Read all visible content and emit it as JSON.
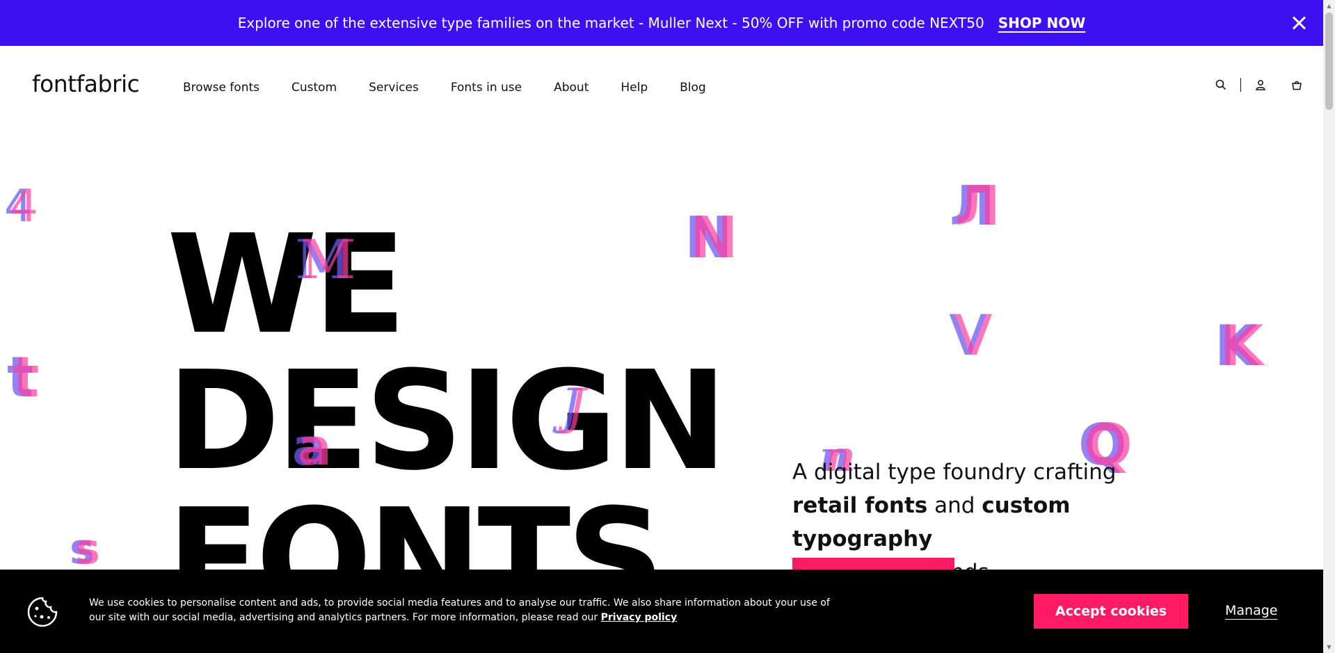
{
  "promo": {
    "text": "Explore one of the extensive type families on the market - Muller Next - 50% OFF with promo code NEXT50",
    "cta": "SHOP NOW",
    "close_icon": "close-icon",
    "background": "#3c10f0"
  },
  "header": {
    "logo": "fontfabric",
    "nav": [
      "Browse fonts",
      "Custom",
      "Services",
      "Fonts in use",
      "About",
      "Help",
      "Blog"
    ],
    "icons": [
      "search-icon",
      "user-icon",
      "cart-icon"
    ]
  },
  "hero": {
    "line1": "WE",
    "line2": "DESIGN",
    "line3": "FONTS",
    "glyphs": [
      "4",
      "N",
      "Л",
      "t",
      "V",
      "K",
      "M",
      "a",
      "J",
      "Q",
      "n",
      "s"
    ],
    "tagline_start": "A digital type foundry crafting",
    "tagline_bold1": "retail fonts",
    "tagline_and": "and",
    "tagline_bold2": "custom typography",
    "tagline_end": "for various brands.",
    "accent": "#ff1a66"
  },
  "cookie": {
    "text": "We use cookies to personalise content and ads, to provide social media features and to analyse our traffic. We also share information about your use of our site with our social media, advertising and analytics partners. For more information, please read our",
    "link": "Privacy policy",
    "accept": "Accept cookies",
    "manage": "Manage",
    "icon": "cookie-icon"
  }
}
